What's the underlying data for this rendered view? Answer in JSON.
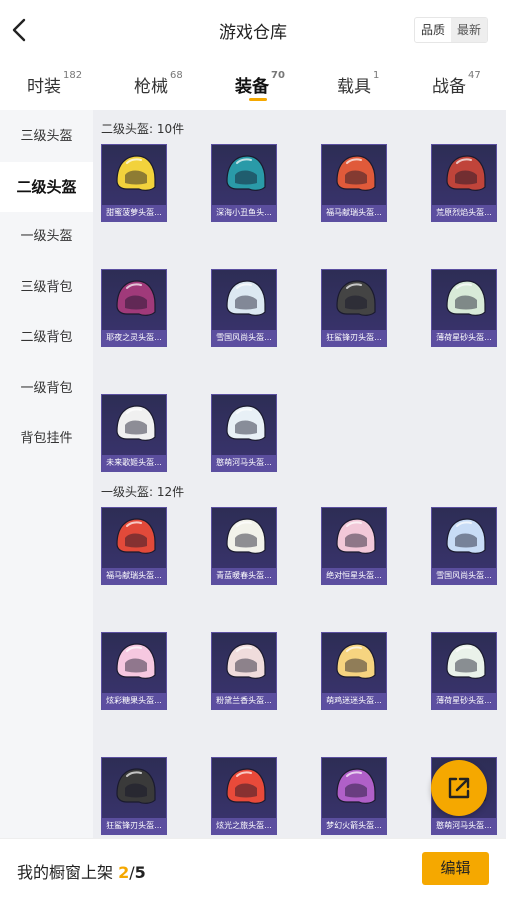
{
  "header": {
    "title": "游戏仓库",
    "sort": [
      "品质",
      "最新"
    ]
  },
  "tabs": [
    {
      "label": "时装",
      "count": "182"
    },
    {
      "label": "枪械",
      "count": "68"
    },
    {
      "label": "装备",
      "count": "70"
    },
    {
      "label": "载具",
      "count": "1"
    },
    {
      "label": "战备",
      "count": "47"
    }
  ],
  "sidebar": [
    "三级头盔",
    "二级头盔",
    "一级头盔",
    "三级背包",
    "二级背包",
    "一级背包",
    "背包挂件"
  ],
  "sections": [
    {
      "title": "二级头盔: 10件",
      "items": [
        "甜蜜菠萝头盔...",
        "深海小丑鱼头...",
        "福马献瑞头盔...",
        "荒原烈焰头盔...",
        "耶夜之灵头盔...",
        "雪国风尚头盔...",
        "狂鲨锋刃头盔...",
        "薄荷星砂头盔...",
        "未来歌姬头盔...",
        "憨萌河马头盔..."
      ]
    },
    {
      "title": "一级头盔: 12件",
      "items": [
        "福马献瑞头盔...",
        "青蓝暖春头盔...",
        "绝对恒星头盔...",
        "雪国风尚头盔...",
        "炫彩糖果头盔...",
        "粉黛兰香头盔...",
        "萌鸡迷迷头盔...",
        "薄荷星砂头盔...",
        "狂鲨锋刃头盔...",
        "炫光之旅头盔...",
        "梦幻火箭头盔...",
        "憨萌河马头盔..."
      ]
    }
  ],
  "helmet_colors": {
    "s0": [
      "#f2d23c",
      "#2a9aa8",
      "#e05a3a",
      "#c0443a",
      "#a03a7a",
      "#dce8f2",
      "#444444",
      "#d8ead8",
      "#f0f0f0",
      "#e8f0f6"
    ],
    "s1": [
      "#e24a3a",
      "#f2f2ea",
      "#f2c8d8",
      "#c8dcf6",
      "#f6c8e0",
      "#f0dcdc",
      "#f6d480",
      "#eaf2ea",
      "#3a3a3a",
      "#e84a3a",
      "#b060c8",
      "#f0f0f0"
    ]
  },
  "bottom": {
    "shelf_label": "我的橱窗上架",
    "shelf_count": "2",
    "shelf_sep": "/",
    "shelf_total": "5",
    "edit_label": "编辑"
  },
  "icons": {
    "back": "chevron-left-icon",
    "share": "share-external-icon"
  },
  "colors": {
    "accent": "#f5a800",
    "card_bg": "#2d2d55"
  }
}
